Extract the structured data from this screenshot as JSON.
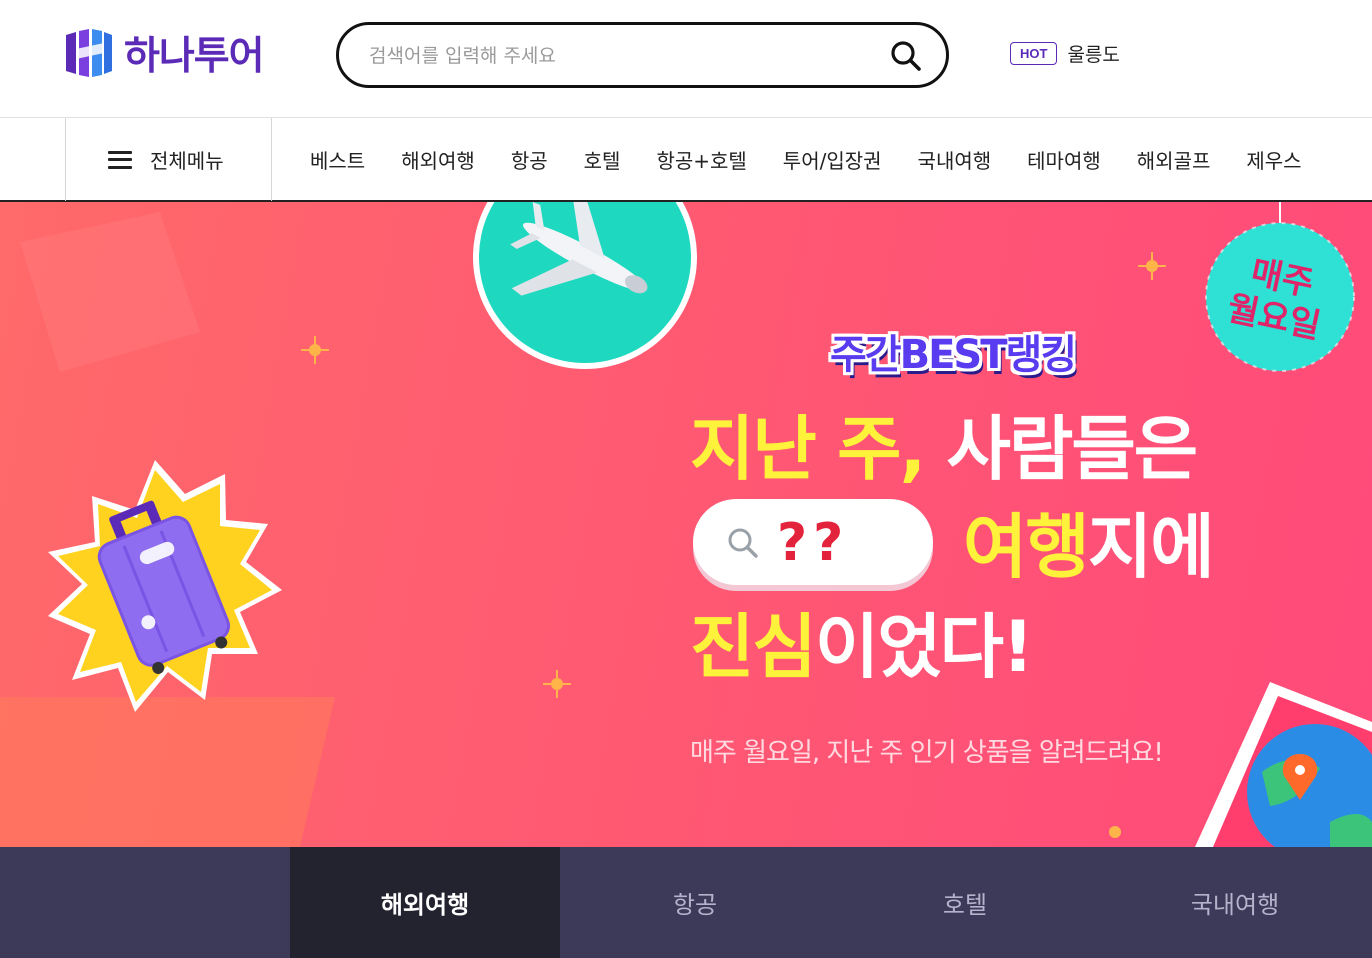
{
  "header": {
    "logo_text": "하나투어",
    "search_placeholder": "검색어를 입력해 주세요",
    "search_icon": "search-icon",
    "hot_badge": "HOT",
    "hot_keyword": "울릉도"
  },
  "gnb": {
    "all_menu_label": "전체메뉴",
    "items": [
      "베스트",
      "해외여행",
      "항공",
      "호텔",
      "항공+호텔",
      "투어/입장권",
      "국내여행",
      "테마여행",
      "해외골프",
      "제우스"
    ]
  },
  "hero": {
    "badge_line1": "매주",
    "badge_line2": "월요일",
    "rank_title": "주간BEST랭킹",
    "line1_yellow": "지난 주,",
    "line1_white": " 사람들은",
    "question": "??",
    "line2_yellow": "여행",
    "line2_white": "지에",
    "line3_yellow": "진심",
    "line3_white": "이었다!",
    "sub_text": "매주 월요일, 지난 주 인기 상품을 알려드려요!"
  },
  "tabs": {
    "items": [
      "해외여행",
      "항공",
      "호텔",
      "국내여행"
    ],
    "active": "해외여행"
  },
  "colors": {
    "brand_purple": "#5b2bb8",
    "banner_pink": "#ff5a72",
    "headline_yellow": "#fff23a",
    "tab_bar": "#3c3a58",
    "tab_active": "#23222f"
  }
}
